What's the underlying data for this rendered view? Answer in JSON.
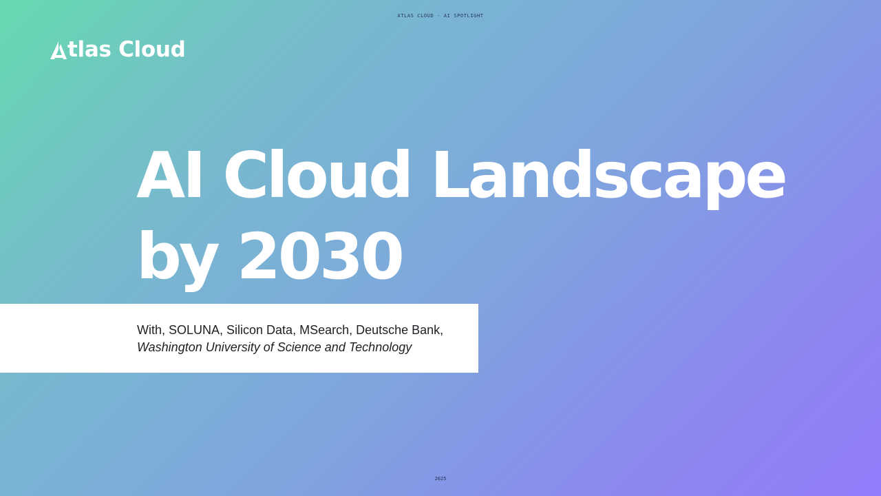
{
  "header": {
    "top_label": "ATLAS CLOUD - AI SPOTLIGHT"
  },
  "logo": {
    "text": "tlas Cloud",
    "icon": "atlas-a-logo-icon"
  },
  "headline": {
    "line1": "AI Cloud Landscape",
    "line2": "by 2030"
  },
  "partners": {
    "line1": "With, SOLUNA, Silicon Data, MSearch, Deutsche Bank,",
    "line2": "Washington University of Science and Technology"
  },
  "footer": {
    "year": "2025"
  },
  "colors": {
    "gradient_start": "#66d9b0",
    "gradient_end": "#937cfb",
    "text_light": "#ffffff",
    "text_dark": "#1f1f24"
  }
}
